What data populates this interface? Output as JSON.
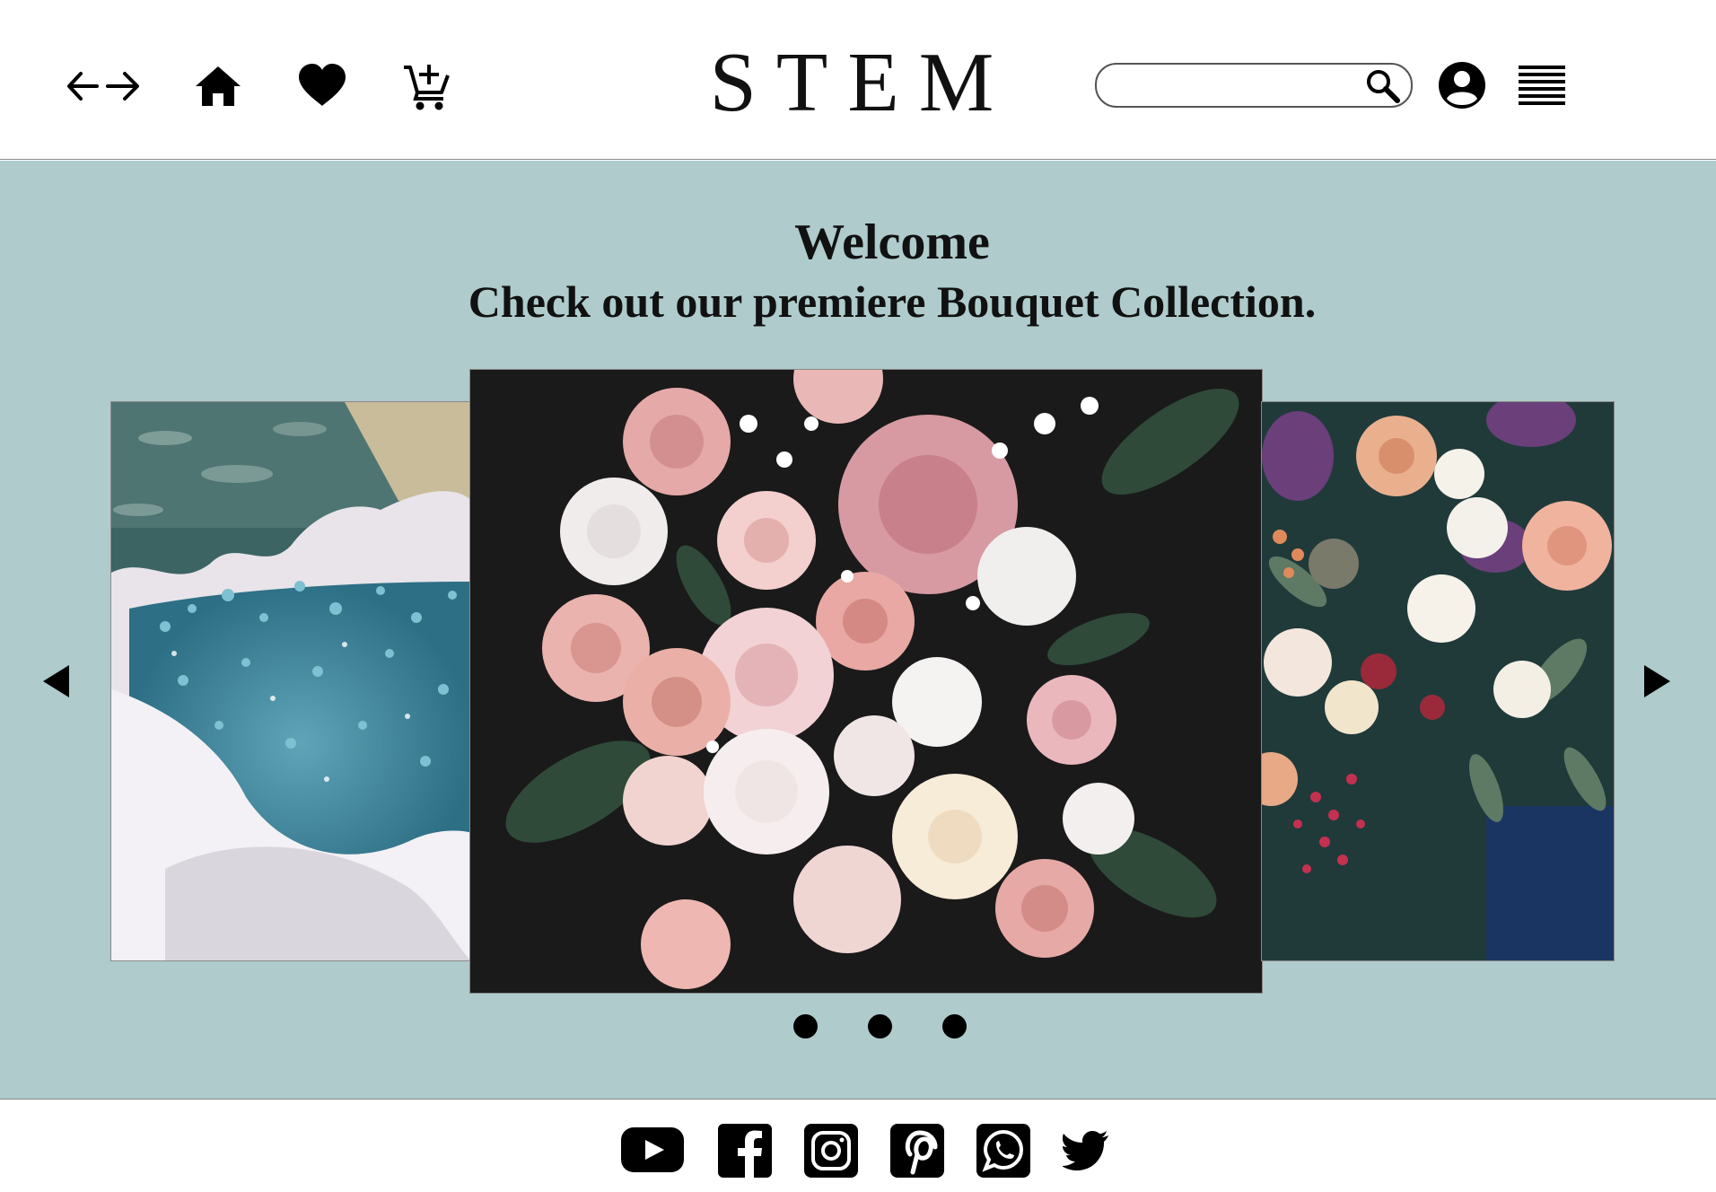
{
  "header": {
    "brand": "STEM",
    "search": {
      "placeholder": "",
      "value": ""
    },
    "icons": [
      "back-forward-arrows-icon",
      "home-icon",
      "heart-icon",
      "add-to-cart-icon",
      "search-icon",
      "account-icon",
      "menu-icon"
    ]
  },
  "hero": {
    "welcome": "Welcome",
    "tagline": "Check out our premiere Bouquet Collection.",
    "background_color": "#afcbcc",
    "carousel": {
      "slides": [
        "blue-gypsophila-bouquet",
        "pink-rose-peony-bouquet",
        "mixed-rose-berry-bouquet"
      ],
      "dot_count": 3,
      "active_slide": 2
    }
  },
  "footer": {
    "social_icons": [
      "youtube-icon",
      "facebook-icon",
      "instagram-icon",
      "pinterest-icon",
      "whatsapp-icon",
      "twitter-icon"
    ]
  }
}
